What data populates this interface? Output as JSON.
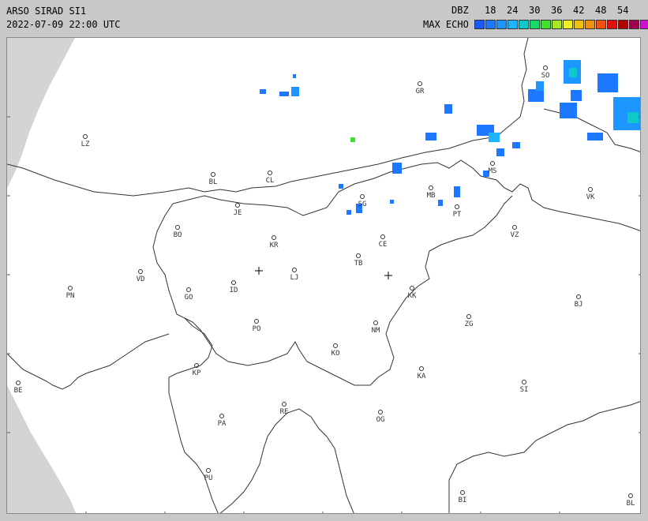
{
  "header": {
    "title": "ARSO SIRAD SI1",
    "datetime": "2022-07-09 22:00 UTC"
  },
  "legend": {
    "unit_label": "DBZ",
    "product_label": "MAX ECHO",
    "tick_labels": [
      "18",
      "24",
      "30",
      "36",
      "42",
      "48",
      "54"
    ],
    "colors": [
      "#1a5aff",
      "#1e78ff",
      "#1e96ff",
      "#1eb4ff",
      "#10c8c8",
      "#18d86c",
      "#40e030",
      "#a8e820",
      "#f0f020",
      "#f0c010",
      "#f09010",
      "#f05010",
      "#e01010",
      "#b00000",
      "#a00050",
      "#d010d0"
    ]
  },
  "map": {
    "cities": [
      {
        "code": "SO"
      },
      {
        "code": "GR"
      },
      {
        "code": "LZ"
      },
      {
        "code": "BL"
      },
      {
        "code": "CL"
      },
      {
        "code": "MB"
      },
      {
        "code": "MS"
      },
      {
        "code": "VK"
      },
      {
        "code": "JE"
      },
      {
        "code": "SG"
      },
      {
        "code": "PT"
      },
      {
        "code": "BO"
      },
      {
        "code": "KR"
      },
      {
        "code": "CE"
      },
      {
        "code": "VZ"
      },
      {
        "code": "VD"
      },
      {
        "code": "TB"
      },
      {
        "code": "LJ"
      },
      {
        "code": "PN"
      },
      {
        "code": "ID"
      },
      {
        "code": "GO"
      },
      {
        "code": "KK"
      },
      {
        "code": "BJ"
      },
      {
        "code": "ZG"
      },
      {
        "code": "PO"
      },
      {
        "code": "NM"
      },
      {
        "code": "KO"
      },
      {
        "code": "KP"
      },
      {
        "code": "KA"
      },
      {
        "code": "SI"
      },
      {
        "code": "BE"
      },
      {
        "code": "RE"
      },
      {
        "code": "PA"
      },
      {
        "code": "OG"
      },
      {
        "code": "PU"
      },
      {
        "code": "BI"
      },
      {
        "code": "BL"
      }
    ]
  }
}
